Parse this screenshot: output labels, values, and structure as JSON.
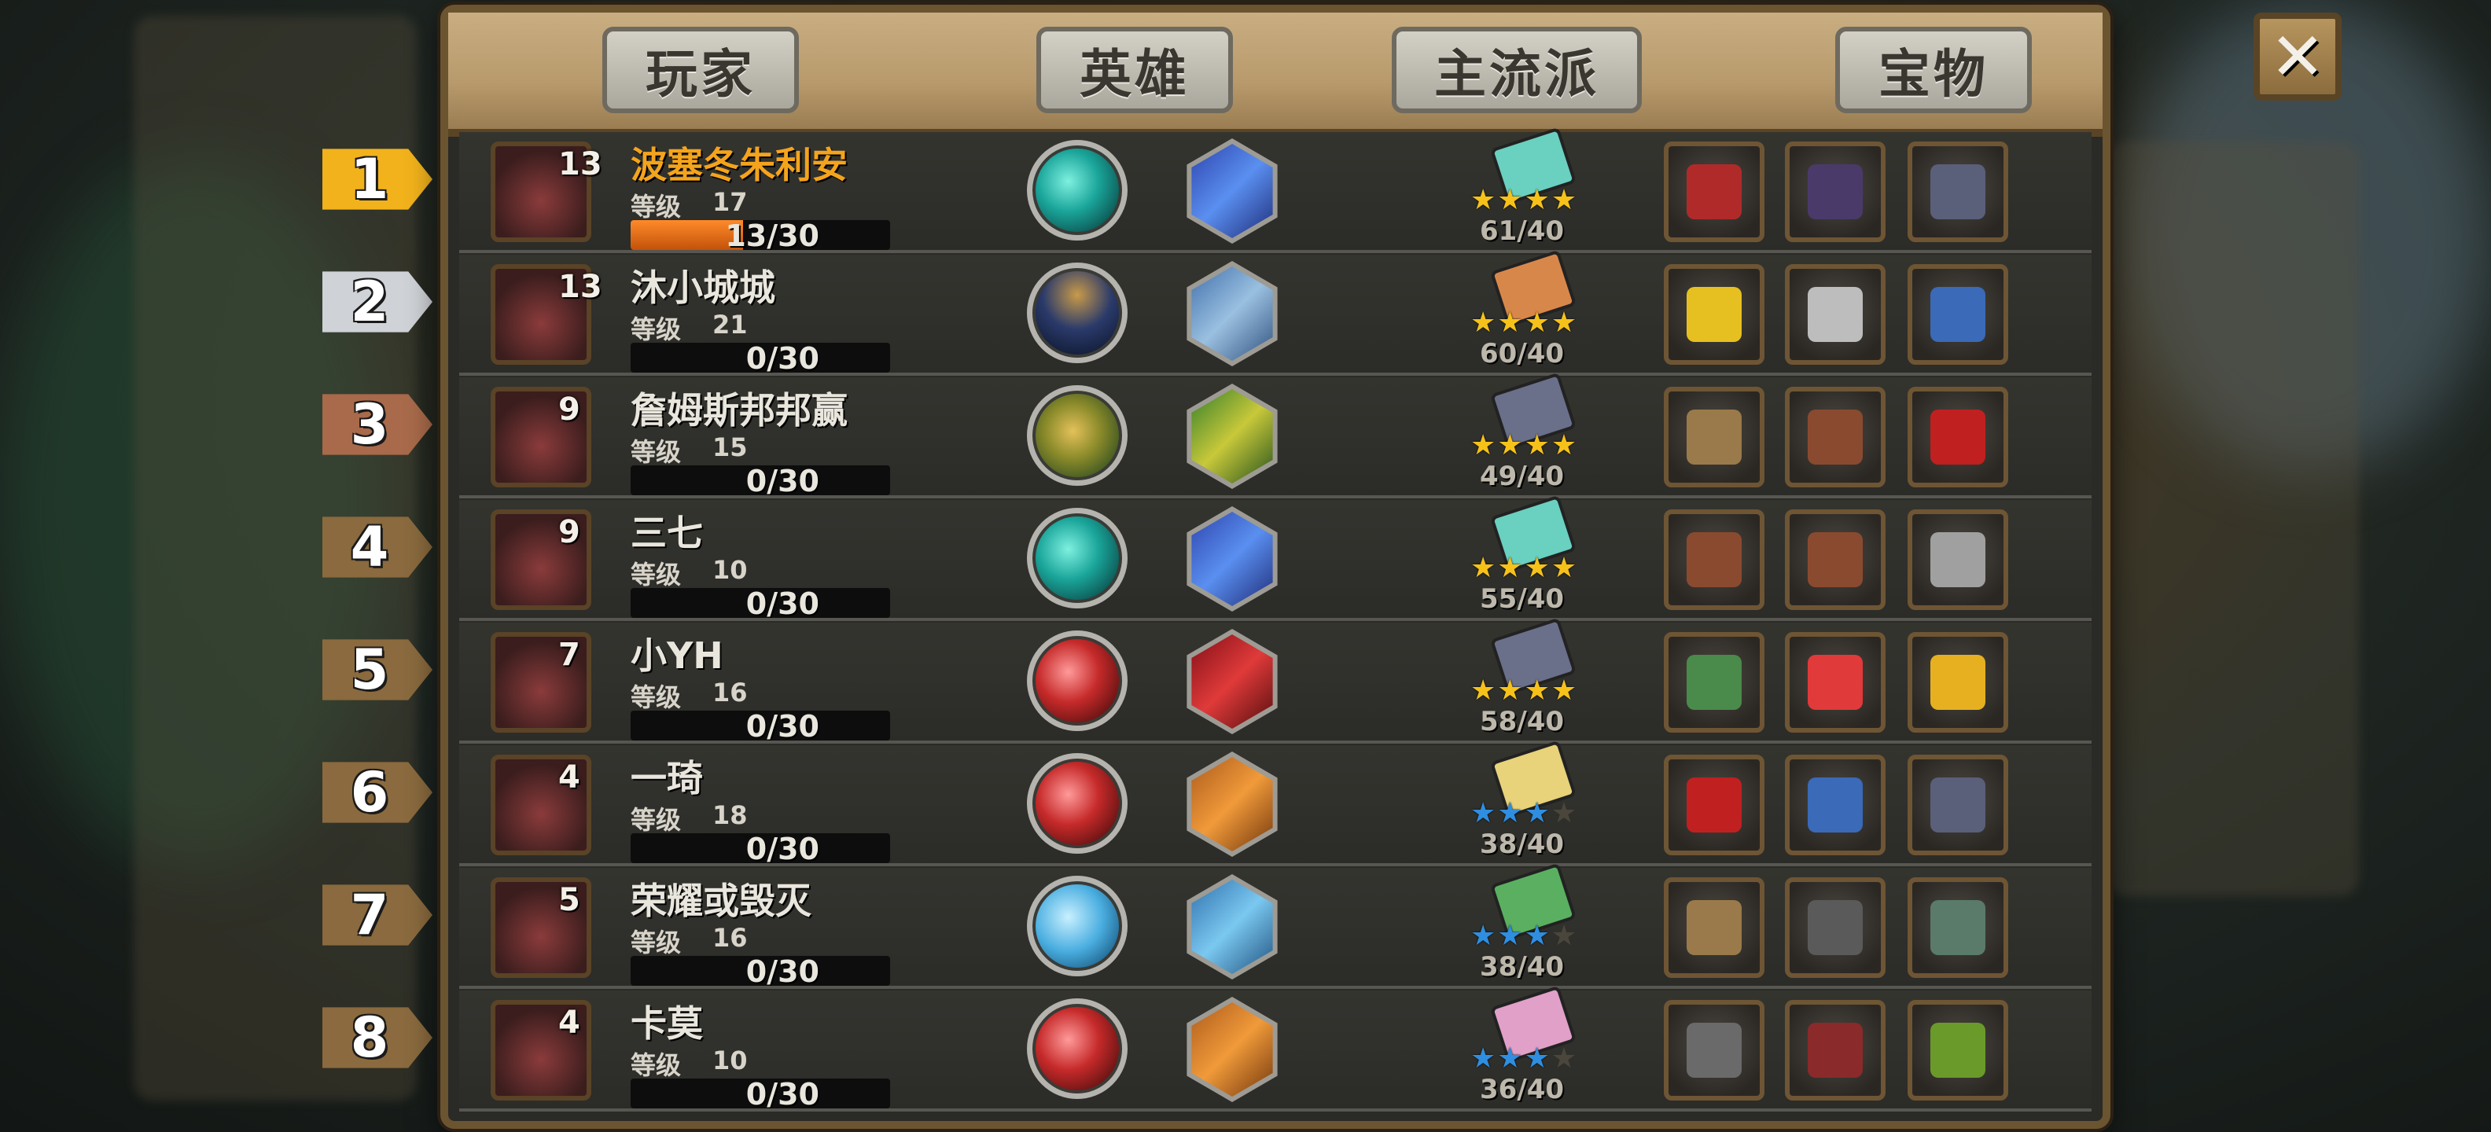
{
  "header": {
    "tabs": [
      "玩家",
      "英雄",
      "主流派",
      "宝物"
    ],
    "close_label": "✕"
  },
  "colors": {
    "gold_rank": "#f2b21c",
    "silver_rank": "#cfd2d6",
    "bronze_rank": "#a86a4a",
    "wood_rank": "#8a6a3e",
    "top_name": "#f4a41c",
    "xp_fill": "#ff8a2a"
  },
  "players": [
    {
      "rank": "1",
      "name": "波塞冬朱利安",
      "hero_level": "13",
      "grade_label": "等级",
      "grade": "17",
      "xp_current": "13",
      "xp_total": "/30",
      "xp_fraction": 0.433,
      "school_score": "61/40",
      "stars_filled": 4,
      "star_color": "gold",
      "orb": "teal",
      "hex": "blue",
      "book": "teal",
      "items": [
        "rocket-boot",
        "twin-blade",
        "spell-book"
      ]
    },
    {
      "rank": "2",
      "name": "沐小城城",
      "hero_level": "13",
      "grade_label": "等级",
      "grade": "21",
      "xp_current": "0",
      "xp_total": "/30",
      "xp_fraction": 0,
      "school_score": "60/40",
      "stars_filled": 4,
      "star_color": "gold",
      "orb": "navy",
      "hex": "steel",
      "book": "orange",
      "items": [
        "clover",
        "skull-ring",
        "lantern"
      ]
    },
    {
      "rank": "3",
      "name": "詹姆斯邦邦赢",
      "hero_level": "9",
      "grade_label": "等级",
      "grade": "15",
      "xp_current": "0",
      "xp_total": "/30",
      "xp_fraction": 0,
      "school_score": "49/40",
      "stars_filled": 4,
      "star_color": "gold",
      "orb": "gold-green",
      "hex": "green",
      "book": "slate",
      "items": [
        "staff",
        "leather-armor",
        "red-hood"
      ]
    },
    {
      "rank": "4",
      "name": "三七",
      "hero_level": "9",
      "grade_label": "等级",
      "grade": "10",
      "xp_current": "0",
      "xp_total": "/30",
      "xp_fraction": 0,
      "school_score": "55/40",
      "stars_filled": 4,
      "star_color": "gold",
      "orb": "teal",
      "hex": "blue",
      "book": "teal",
      "items": [
        "leather-armor",
        "leather-armor",
        "scales"
      ]
    },
    {
      "rank": "5",
      "name": "小YH",
      "hero_level": "7",
      "grade_label": "等级",
      "grade": "16",
      "xp_current": "0",
      "xp_total": "/30",
      "xp_fraction": 0,
      "school_score": "58/40",
      "stars_filled": 4,
      "star_color": "gold",
      "orb": "red",
      "hex": "crimson",
      "book": "slate",
      "items": [
        "green-book",
        "red-crystal",
        "gold-ingot"
      ]
    },
    {
      "rank": "6",
      "name": "一琦",
      "hero_level": "4",
      "grade_label": "等级",
      "grade": "18",
      "xp_current": "0",
      "xp_total": "/30",
      "xp_fraction": 0,
      "school_score": "38/40",
      "stars_filled": 3,
      "star_color": "blue",
      "orb": "red",
      "hex": "orange-chomper",
      "book": "yellow",
      "items": [
        "red-hood",
        "lantern",
        "spell-book"
      ]
    },
    {
      "rank": "7",
      "name": "荣耀或毁灭",
      "hero_level": "5",
      "grade_label": "等级",
      "grade": "16",
      "xp_current": "0",
      "xp_total": "/30",
      "xp_fraction": 0,
      "school_score": "38/40",
      "stars_filled": 3,
      "star_color": "blue",
      "orb": "light-blue",
      "hex": "ice",
      "book": "green",
      "items": [
        "staff",
        "rune-tablet",
        "bronze-coin"
      ]
    },
    {
      "rank": "8",
      "name": "卡莫",
      "hero_level": "4",
      "grade_label": "等级",
      "grade": "10",
      "xp_current": "0",
      "xp_total": "/30",
      "xp_fraction": 0,
      "school_score": "36/40",
      "stars_filled": 3,
      "star_color": "blue",
      "orb": "red",
      "hex": "orange-chomper",
      "book": "pink",
      "items": [
        "desk",
        "red-tome",
        "green-tome"
      ]
    }
  ]
}
